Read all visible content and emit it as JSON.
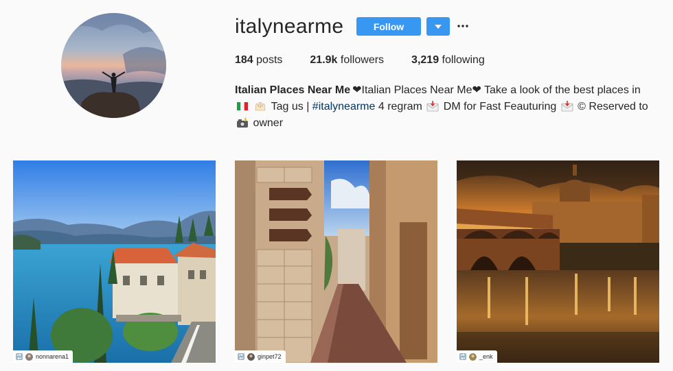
{
  "profile": {
    "username": "italynearme",
    "follow_label": "Follow",
    "stats": {
      "posts_count": "184",
      "posts_label": "posts",
      "followers_count": "21.9k",
      "followers_label": "followers",
      "following_count": "3,219",
      "following_label": "following"
    },
    "bio": {
      "name": "Italian Places Near Me",
      "line1_rest": "Italian Places Near Me",
      "line1_tail": " Take a look of the best places in",
      "tag_text": " Tag us | ",
      "hashtag": "#italynearme",
      "regram_text": " 4 regram ",
      "dm_text": " DM for Fast Feauturing ",
      "reserved_text": " © Reserved to",
      "owner_text": " owner"
    }
  },
  "posts": [
    {
      "credit": "nonnarena1"
    },
    {
      "credit": "ginpet72"
    },
    {
      "credit": "_enk"
    }
  ],
  "colors": {
    "accent": "#3897f0",
    "hashtag": "#003569",
    "text": "#262626",
    "background": "#fafafa"
  }
}
